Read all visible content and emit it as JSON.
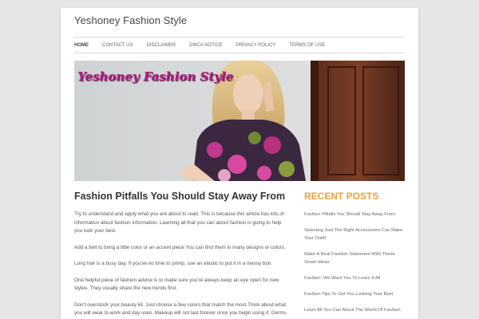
{
  "site": {
    "title": "Yeshoney Fashion Style"
  },
  "nav": {
    "items": [
      {
        "label": "HOME"
      },
      {
        "label": "CONTACT US"
      },
      {
        "label": "DISCLAIMER"
      },
      {
        "label": "DMCA NOTICE"
      },
      {
        "label": "PRIVACY POLICY"
      },
      {
        "label": "TERMS OF USE"
      }
    ]
  },
  "banner": {
    "text": "Yeshoney Fashion Style"
  },
  "post": {
    "title": "Fashion Pitfalls You Should Stay Away From",
    "paragraphs": [
      "Try to understand and apply what you are about to read. This is because this article has lots of information about fashion information. Learning all that you can about fashion is going to help you look your best.",
      "Add a belt to bring a little color or an accent piece You can find them in many designs or colors.",
      "Long hair is a busy day. If you've no time to primp, use an elastic to put it in a messy bun.",
      "One helpful piece of fashion advice is to make sure you're always keep an eye open for new styles. They usually share the new trends first.",
      "Don't overstock your beauty kit. Just choose a few colors that match the most.Think about what you will wear to work and day uses. Makeup will not last forever once you begin using it. Germs"
    ]
  },
  "sidebar": {
    "title": "RECENT POSTS",
    "posts": [
      "Fashion Pitfalls You Should Stay Away From",
      "Selecting Just The Right Accessories Can Make Your Outfit",
      "Make A Real Fashion Statement With These Smart Ideas",
      "Fashion: We Want You To Learn It All",
      "Fashion Tips To Get You Looking Your Best",
      "Learn All You Can About The World Of Fashion"
    ]
  },
  "colors": {
    "accent": "#e8a13a",
    "banner_text": "#b01f86",
    "background": "#e6e6e6"
  }
}
